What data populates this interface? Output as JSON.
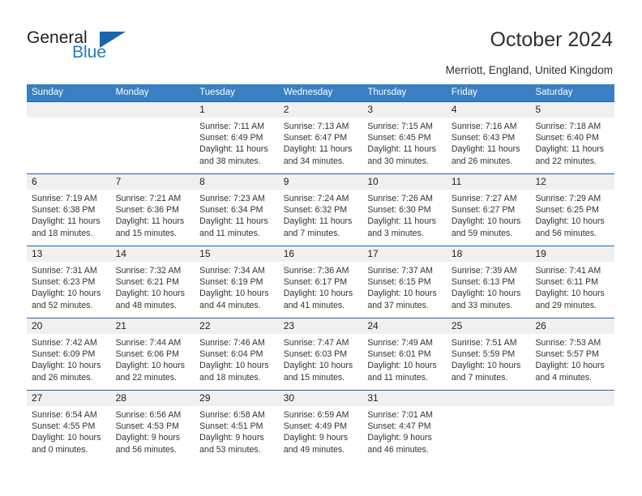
{
  "brand": {
    "name_part1": "General",
    "name_part2": "Blue",
    "triangle_icon": "triangle-icon",
    "accent_color": "#1667b0",
    "logo_blue": "#1f7ac4"
  },
  "header": {
    "title": "October 2024",
    "subtitle": "Merriott, England, United Kingdom"
  },
  "calendar": {
    "header_bg": "#3a7fc1",
    "band_bg": "#f0f0f0",
    "separator_color": "#1667b0",
    "weekdays": [
      "Sunday",
      "Monday",
      "Tuesday",
      "Wednesday",
      "Thursday",
      "Friday",
      "Saturday"
    ],
    "weeks": [
      [
        {
          "date": "",
          "sunrise": "",
          "sunset": "",
          "daylight_line1": "",
          "daylight_line2": "",
          "empty": true
        },
        {
          "date": "",
          "sunrise": "",
          "sunset": "",
          "daylight_line1": "",
          "daylight_line2": "",
          "empty": true
        },
        {
          "date": "1",
          "sunrise": "Sunrise: 7:11 AM",
          "sunset": "Sunset: 6:49 PM",
          "daylight_line1": "Daylight: 11 hours",
          "daylight_line2": "and 38 minutes.",
          "empty": false
        },
        {
          "date": "2",
          "sunrise": "Sunrise: 7:13 AM",
          "sunset": "Sunset: 6:47 PM",
          "daylight_line1": "Daylight: 11 hours",
          "daylight_line2": "and 34 minutes.",
          "empty": false
        },
        {
          "date": "3",
          "sunrise": "Sunrise: 7:15 AM",
          "sunset": "Sunset: 6:45 PM",
          "daylight_line1": "Daylight: 11 hours",
          "daylight_line2": "and 30 minutes.",
          "empty": false
        },
        {
          "date": "4",
          "sunrise": "Sunrise: 7:16 AM",
          "sunset": "Sunset: 6:43 PM",
          "daylight_line1": "Daylight: 11 hours",
          "daylight_line2": "and 26 minutes.",
          "empty": false
        },
        {
          "date": "5",
          "sunrise": "Sunrise: 7:18 AM",
          "sunset": "Sunset: 6:40 PM",
          "daylight_line1": "Daylight: 11 hours",
          "daylight_line2": "and 22 minutes.",
          "empty": false
        }
      ],
      [
        {
          "date": "6",
          "sunrise": "Sunrise: 7:19 AM",
          "sunset": "Sunset: 6:38 PM",
          "daylight_line1": "Daylight: 11 hours",
          "daylight_line2": "and 18 minutes.",
          "empty": false
        },
        {
          "date": "7",
          "sunrise": "Sunrise: 7:21 AM",
          "sunset": "Sunset: 6:36 PM",
          "daylight_line1": "Daylight: 11 hours",
          "daylight_line2": "and 15 minutes.",
          "empty": false
        },
        {
          "date": "8",
          "sunrise": "Sunrise: 7:23 AM",
          "sunset": "Sunset: 6:34 PM",
          "daylight_line1": "Daylight: 11 hours",
          "daylight_line2": "and 11 minutes.",
          "empty": false
        },
        {
          "date": "9",
          "sunrise": "Sunrise: 7:24 AM",
          "sunset": "Sunset: 6:32 PM",
          "daylight_line1": "Daylight: 11 hours",
          "daylight_line2": "and 7 minutes.",
          "empty": false
        },
        {
          "date": "10",
          "sunrise": "Sunrise: 7:26 AM",
          "sunset": "Sunset: 6:30 PM",
          "daylight_line1": "Daylight: 11 hours",
          "daylight_line2": "and 3 minutes.",
          "empty": false
        },
        {
          "date": "11",
          "sunrise": "Sunrise: 7:27 AM",
          "sunset": "Sunset: 6:27 PM",
          "daylight_line1": "Daylight: 10 hours",
          "daylight_line2": "and 59 minutes.",
          "empty": false
        },
        {
          "date": "12",
          "sunrise": "Sunrise: 7:29 AM",
          "sunset": "Sunset: 6:25 PM",
          "daylight_line1": "Daylight: 10 hours",
          "daylight_line2": "and 56 minutes.",
          "empty": false
        }
      ],
      [
        {
          "date": "13",
          "sunrise": "Sunrise: 7:31 AM",
          "sunset": "Sunset: 6:23 PM",
          "daylight_line1": "Daylight: 10 hours",
          "daylight_line2": "and 52 minutes.",
          "empty": false
        },
        {
          "date": "14",
          "sunrise": "Sunrise: 7:32 AM",
          "sunset": "Sunset: 6:21 PM",
          "daylight_line1": "Daylight: 10 hours",
          "daylight_line2": "and 48 minutes.",
          "empty": false
        },
        {
          "date": "15",
          "sunrise": "Sunrise: 7:34 AM",
          "sunset": "Sunset: 6:19 PM",
          "daylight_line1": "Daylight: 10 hours",
          "daylight_line2": "and 44 minutes.",
          "empty": false
        },
        {
          "date": "16",
          "sunrise": "Sunrise: 7:36 AM",
          "sunset": "Sunset: 6:17 PM",
          "daylight_line1": "Daylight: 10 hours",
          "daylight_line2": "and 41 minutes.",
          "empty": false
        },
        {
          "date": "17",
          "sunrise": "Sunrise: 7:37 AM",
          "sunset": "Sunset: 6:15 PM",
          "daylight_line1": "Daylight: 10 hours",
          "daylight_line2": "and 37 minutes.",
          "empty": false
        },
        {
          "date": "18",
          "sunrise": "Sunrise: 7:39 AM",
          "sunset": "Sunset: 6:13 PM",
          "daylight_line1": "Daylight: 10 hours",
          "daylight_line2": "and 33 minutes.",
          "empty": false
        },
        {
          "date": "19",
          "sunrise": "Sunrise: 7:41 AM",
          "sunset": "Sunset: 6:11 PM",
          "daylight_line1": "Daylight: 10 hours",
          "daylight_line2": "and 29 minutes.",
          "empty": false
        }
      ],
      [
        {
          "date": "20",
          "sunrise": "Sunrise: 7:42 AM",
          "sunset": "Sunset: 6:09 PM",
          "daylight_line1": "Daylight: 10 hours",
          "daylight_line2": "and 26 minutes.",
          "empty": false
        },
        {
          "date": "21",
          "sunrise": "Sunrise: 7:44 AM",
          "sunset": "Sunset: 6:06 PM",
          "daylight_line1": "Daylight: 10 hours",
          "daylight_line2": "and 22 minutes.",
          "empty": false
        },
        {
          "date": "22",
          "sunrise": "Sunrise: 7:46 AM",
          "sunset": "Sunset: 6:04 PM",
          "daylight_line1": "Daylight: 10 hours",
          "daylight_line2": "and 18 minutes.",
          "empty": false
        },
        {
          "date": "23",
          "sunrise": "Sunrise: 7:47 AM",
          "sunset": "Sunset: 6:03 PM",
          "daylight_line1": "Daylight: 10 hours",
          "daylight_line2": "and 15 minutes.",
          "empty": false
        },
        {
          "date": "24",
          "sunrise": "Sunrise: 7:49 AM",
          "sunset": "Sunset: 6:01 PM",
          "daylight_line1": "Daylight: 10 hours",
          "daylight_line2": "and 11 minutes.",
          "empty": false
        },
        {
          "date": "25",
          "sunrise": "Sunrise: 7:51 AM",
          "sunset": "Sunset: 5:59 PM",
          "daylight_line1": "Daylight: 10 hours",
          "daylight_line2": "and 7 minutes.",
          "empty": false
        },
        {
          "date": "26",
          "sunrise": "Sunrise: 7:53 AM",
          "sunset": "Sunset: 5:57 PM",
          "daylight_line1": "Daylight: 10 hours",
          "daylight_line2": "and 4 minutes.",
          "empty": false
        }
      ],
      [
        {
          "date": "27",
          "sunrise": "Sunrise: 6:54 AM",
          "sunset": "Sunset: 4:55 PM",
          "daylight_line1": "Daylight: 10 hours",
          "daylight_line2": "and 0 minutes.",
          "empty": false
        },
        {
          "date": "28",
          "sunrise": "Sunrise: 6:56 AM",
          "sunset": "Sunset: 4:53 PM",
          "daylight_line1": "Daylight: 9 hours",
          "daylight_line2": "and 56 minutes.",
          "empty": false
        },
        {
          "date": "29",
          "sunrise": "Sunrise: 6:58 AM",
          "sunset": "Sunset: 4:51 PM",
          "daylight_line1": "Daylight: 9 hours",
          "daylight_line2": "and 53 minutes.",
          "empty": false
        },
        {
          "date": "30",
          "sunrise": "Sunrise: 6:59 AM",
          "sunset": "Sunset: 4:49 PM",
          "daylight_line1": "Daylight: 9 hours",
          "daylight_line2": "and 49 minutes.",
          "empty": false
        },
        {
          "date": "31",
          "sunrise": "Sunrise: 7:01 AM",
          "sunset": "Sunset: 4:47 PM",
          "daylight_line1": "Daylight: 9 hours",
          "daylight_line2": "and 46 minutes.",
          "empty": false
        },
        {
          "date": "",
          "sunrise": "",
          "sunset": "",
          "daylight_line1": "",
          "daylight_line2": "",
          "empty": true
        },
        {
          "date": "",
          "sunrise": "",
          "sunset": "",
          "daylight_line1": "",
          "daylight_line2": "",
          "empty": true
        }
      ]
    ]
  }
}
